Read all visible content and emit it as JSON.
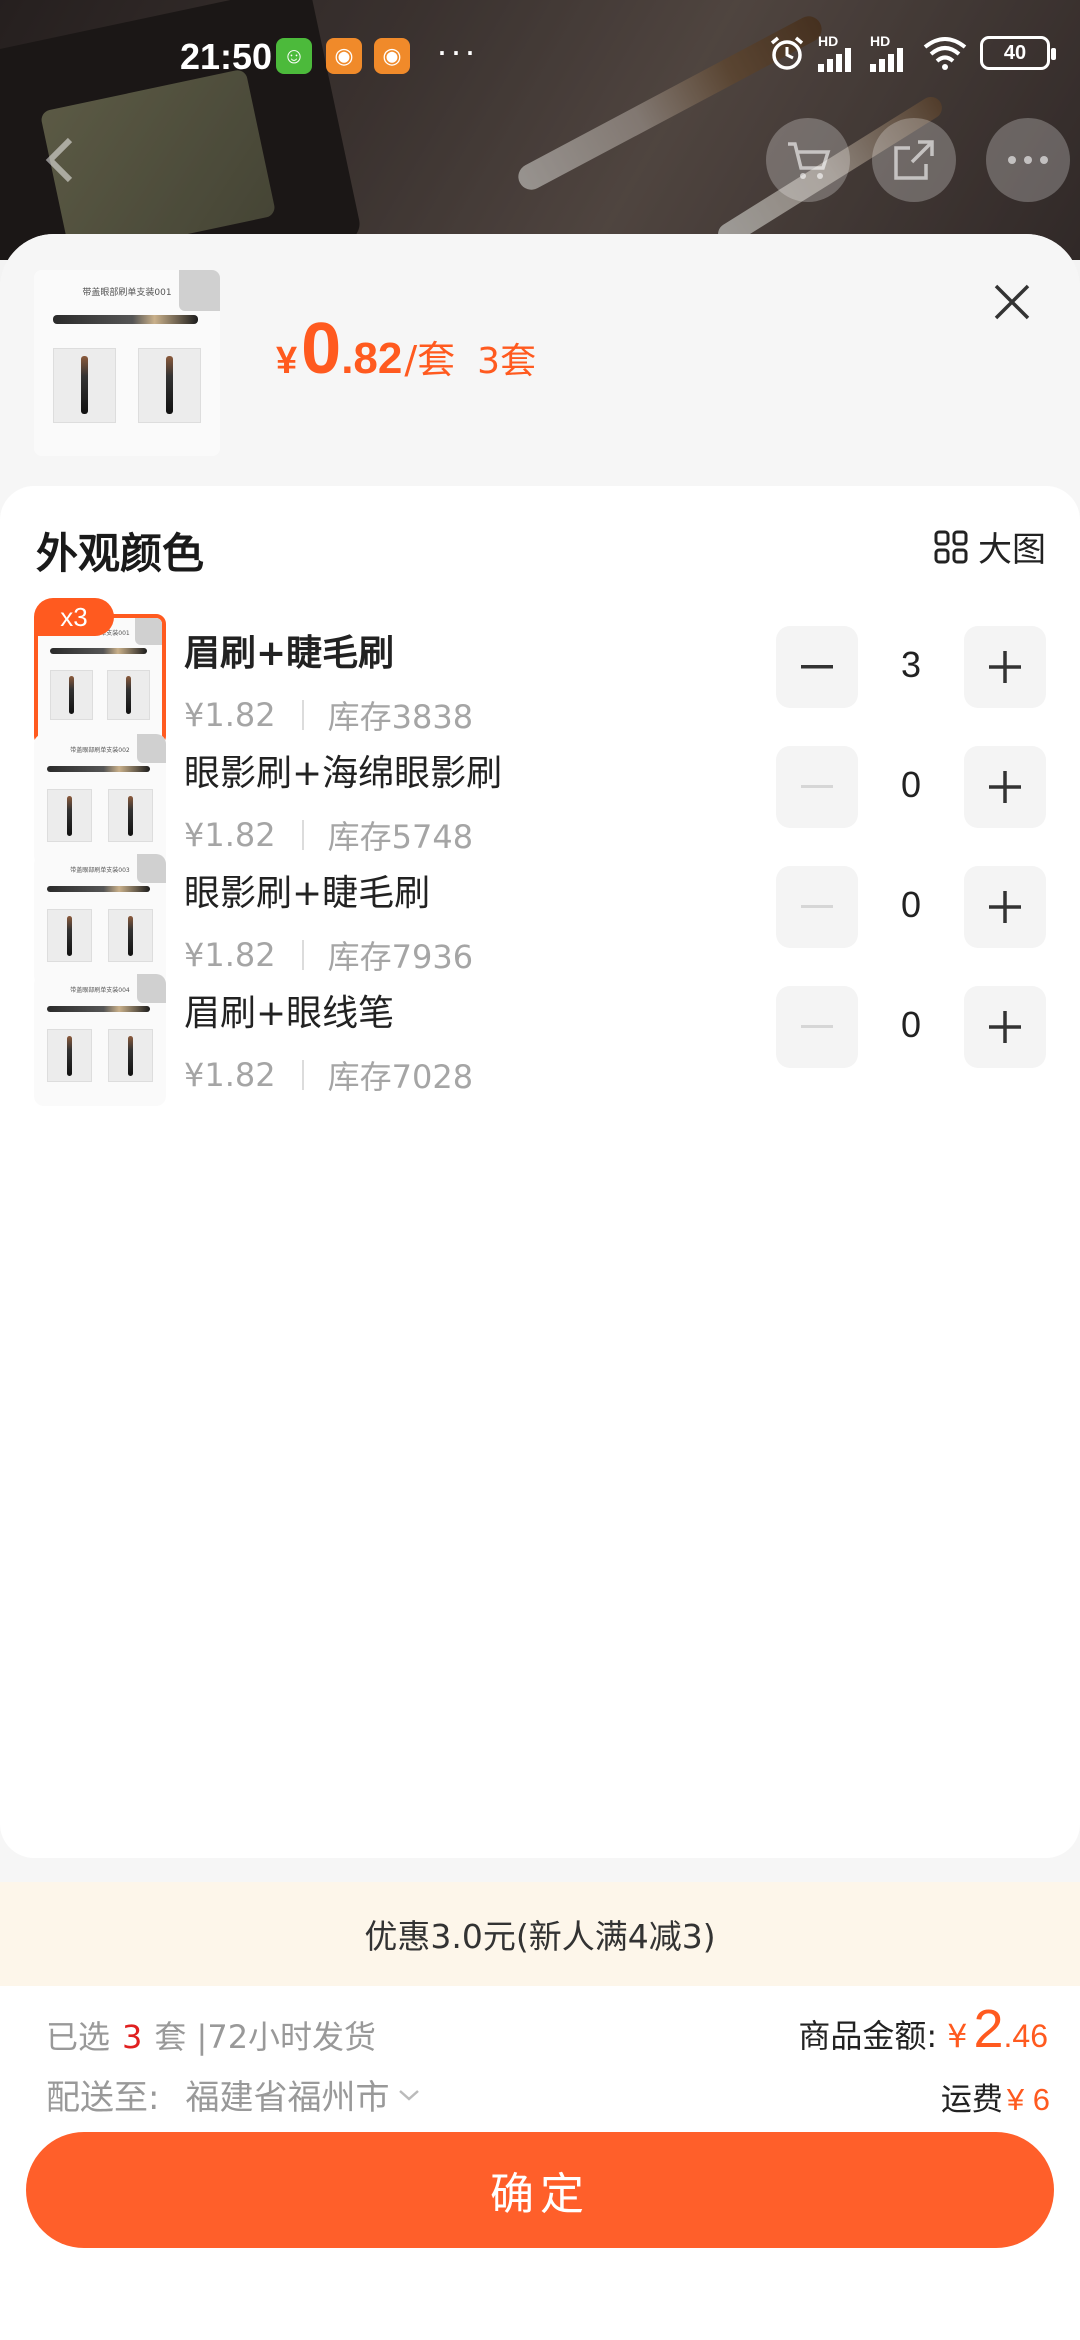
{
  "status_bar": {
    "time": "21:50",
    "dots": "···",
    "hd1": "HD",
    "hd2": "HD",
    "battery": "40"
  },
  "header": {
    "currency": "¥",
    "price_int": "0",
    "price_dec": ".82",
    "unit": "/套",
    "quantity": "3套",
    "thumb_caption": "带盖眼部刷单支装001"
  },
  "panel": {
    "title": "外观颜色",
    "big_view_label": "大图"
  },
  "variants": [
    {
      "badge": "x3",
      "name": "眉刷+睫毛刷",
      "price": "¥1.82",
      "stock": "库存3838",
      "qty": "3",
      "caption": "带盖眼部刷单支装001"
    },
    {
      "name": "眼影刷+海绵眼影刷",
      "price": "¥1.82",
      "stock": "库存5748",
      "qty": "0",
      "caption": "带盖眼部刷单支装002"
    },
    {
      "name": "眼影刷+睫毛刷",
      "price": "¥1.82",
      "stock": "库存7936",
      "qty": "0",
      "caption": "带盖眼部刷单支装003"
    },
    {
      "name": "眉刷+眼线笔",
      "price": "¥1.82",
      "stock": "库存7028",
      "qty": "0",
      "caption": "带盖眼部刷单支装004"
    }
  ],
  "promo": {
    "text": "优惠3.0元(新人满4减3)"
  },
  "footer": {
    "selected_prefix": "已选",
    "selected_count": "3",
    "selected_suffix": "套 |72小时发货",
    "ship_label": "配送至:",
    "ship_region": "福建省福州市",
    "total_label": "商品金额:",
    "total_currency": "¥",
    "total_int": "2",
    "total_dec": ".46",
    "freight_label": "运费",
    "freight_value": "¥ 6",
    "confirm_label": "确定"
  },
  "colors": {
    "accent": "#ff5a1f",
    "button": "#ff5f2a",
    "promo_bg": "#fdf6ea"
  }
}
